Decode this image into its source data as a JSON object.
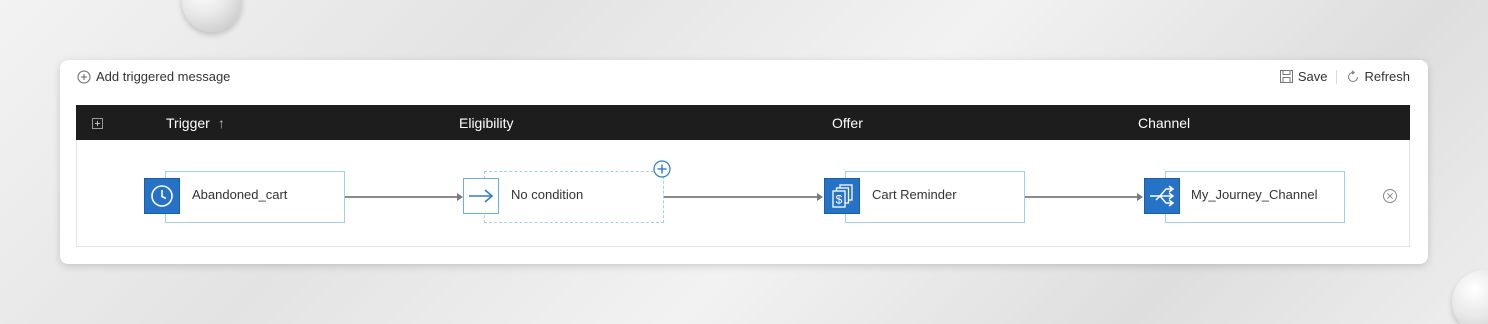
{
  "toolbar": {
    "add_label": "Add triggered message",
    "save_label": "Save",
    "refresh_label": "Refresh"
  },
  "header": {
    "columns": [
      "Trigger",
      "Eligibility",
      "Offer",
      "Channel"
    ],
    "sort_indicator": "↑"
  },
  "flow": {
    "trigger": {
      "label": "Abandoned_cart",
      "icon": "clock-icon"
    },
    "eligibility": {
      "label": "No condition",
      "icon": "arrow-right-icon"
    },
    "offer": {
      "label": "Cart Reminder",
      "icon": "dollar-documents-icon"
    },
    "channel": {
      "label": "My_Journey_Channel",
      "icon": "branch-share-icon"
    }
  },
  "colors": {
    "header_bg": "#1d1d1d",
    "accent_blue": "#2672c7",
    "node_border": "#9fd0ec",
    "connector": "#8b8b8b"
  }
}
